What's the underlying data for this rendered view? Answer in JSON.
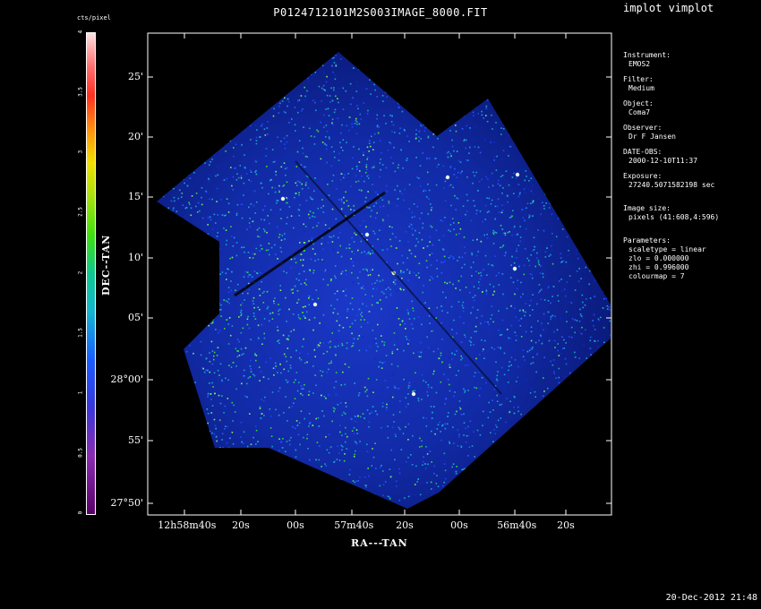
{
  "app_title": "implot vimplot",
  "plot_title": "P0124712101M2S003IMAGE_8000.FIT",
  "timestamp": "20-Dec-2012 21:48",
  "colorbar": {
    "label": "cts/pixel",
    "ticks": [
      "0",
      "0.5",
      "1",
      "1.5",
      "2",
      "2.5",
      "3",
      "3.5",
      "4"
    ],
    "min": 0,
    "max": 4
  },
  "axes": {
    "ylabel": "DEC--TAN",
    "xlabel": "RA---TAN",
    "y_ticks": [
      {
        "deg": "",
        "min": "25'"
      },
      {
        "deg": "",
        "min": "20'"
      },
      {
        "deg": "",
        "min": "15'"
      },
      {
        "deg": "",
        "min": "10'"
      },
      {
        "deg": "",
        "min": "05'"
      },
      {
        "deg": "28°",
        "min": "00'"
      },
      {
        "deg": "",
        "min": "55'"
      },
      {
        "deg": "27°",
        "min": "50'"
      }
    ],
    "x_ticks": [
      "12h58m40s",
      "20s",
      "00s",
      "57m40s",
      "20s",
      "00s",
      "56m40s",
      "20s"
    ]
  },
  "panel": {
    "instrument_label": "Instrument:",
    "instrument": "EMOS2",
    "filter_label": "Filter:",
    "filter": "Medium",
    "object_label": "Object:",
    "object": "Coma7",
    "observer_label": "Observer:",
    "observer": "Dr F Jansen",
    "date_label": "DATE-OBS:",
    "date": "2000-12-10T11:37",
    "exposure_label": "Exposure:",
    "exposure": "27240.5071582198 sec",
    "image_size_label": "Image size:",
    "image_size": "pixels (41:608,4:596)",
    "parameters_label": "Parameters:",
    "scaletype": "scaletype = linear",
    "zlo": "zlo = 0.000000",
    "zhi": "zhi = 0.996000",
    "colourmap": "colourmap =   7"
  },
  "colors": {
    "background": "#000000",
    "foreground": "#ffffff",
    "image_base": "#0a1a8c",
    "image_mid": "#1c3cff",
    "image_high": "#38d838"
  }
}
